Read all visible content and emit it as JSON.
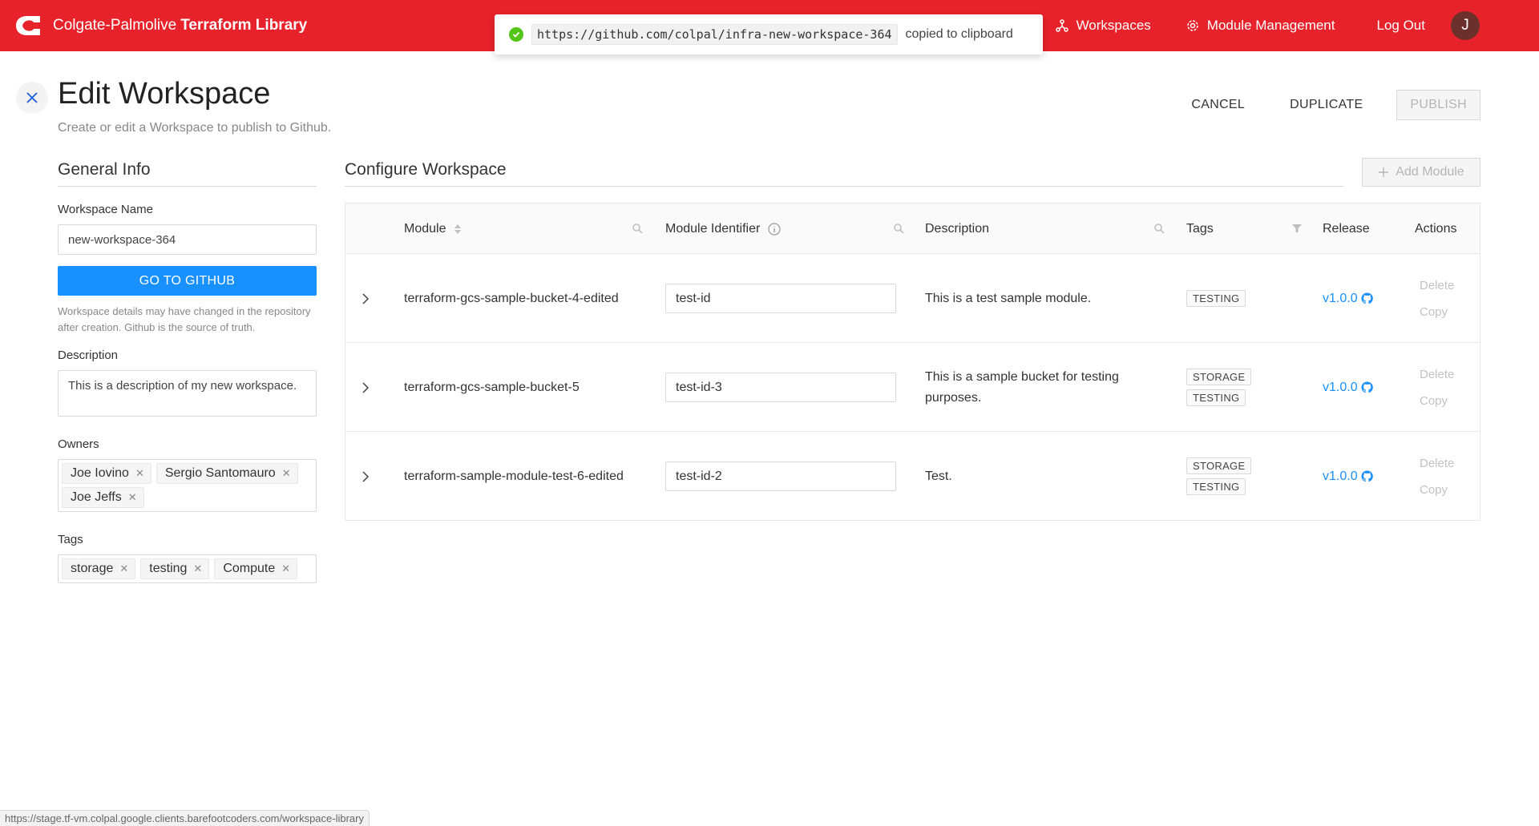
{
  "header": {
    "brand_prefix": "Colgate-Palmolive",
    "brand_suffix": "Terraform Library",
    "nav": [
      {
        "label": "Workspaces",
        "icon": "workspaces-icon"
      },
      {
        "label": "Module Management",
        "icon": "gear-icon"
      }
    ],
    "logout_label": "Log Out",
    "avatar_initial": "J",
    "brand_color": "#e8222a"
  },
  "toast": {
    "url": "https://github.com/colpal/infra-new-workspace-364",
    "message": "copied to clipboard",
    "icon": "check-circle-icon"
  },
  "page": {
    "title": "Edit Workspace",
    "subtitle": "Create or edit a Workspace to publish to Github.",
    "cancel_label": "CANCEL",
    "duplicate_label": "DUPLICATE",
    "publish_label": "PUBLISH"
  },
  "general": {
    "title": "General Info",
    "name_label": "Workspace Name",
    "name_value": "new-workspace-364",
    "github_button": "GO TO GITHUB",
    "help_text": "Workspace details may have changed in the repository after creation. Github is the source of truth.",
    "description_label": "Description",
    "description_value": "This is a description of my new workspace.",
    "owners_label": "Owners",
    "owners": [
      "Joe Iovino",
      "Sergio Santomauro",
      "Joe Jeffs"
    ],
    "tags_label": "Tags",
    "tags": [
      "storage",
      "testing",
      "Compute"
    ]
  },
  "configure": {
    "title": "Configure Workspace",
    "add_module_label": "Add Module",
    "columns": {
      "module": "Module",
      "identifier": "Module Identifier",
      "description": "Description",
      "tags": "Tags",
      "release": "Release",
      "actions": "Actions"
    },
    "rows": [
      {
        "module": "terraform-gcs-sample-bucket-4-edited",
        "identifier": "test-id",
        "description": "This is a test sample module.",
        "tags": [
          "TESTING"
        ],
        "release": "v1.0.0",
        "delete_label": "Delete",
        "copy_label": "Copy"
      },
      {
        "module": "terraform-gcs-sample-bucket-5",
        "identifier": "test-id-3",
        "description": "This is a sample bucket for testing purposes.",
        "tags": [
          "STORAGE",
          "TESTING"
        ],
        "release": "v1.0.0",
        "delete_label": "Delete",
        "copy_label": "Copy"
      },
      {
        "module": "terraform-sample-module-test-6-edited",
        "identifier": "test-id-2",
        "description": "Test.",
        "tags": [
          "STORAGE",
          "TESTING"
        ],
        "release": "v1.0.0",
        "delete_label": "Delete",
        "copy_label": "Copy"
      }
    ]
  },
  "statusbar": {
    "url": "https://stage.tf-vm.colpal.google.clients.barefootcoders.com/workspace-library"
  }
}
